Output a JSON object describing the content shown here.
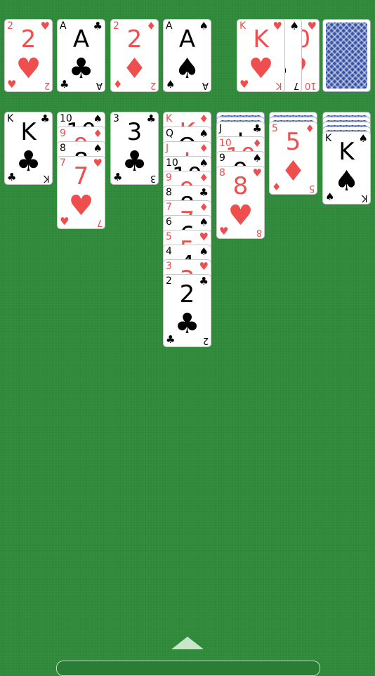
{
  "foundations": [
    {
      "rank": "2",
      "suit": "♥",
      "color": "red"
    },
    {
      "rank": "A",
      "suit": "♣",
      "color": "black"
    },
    {
      "rank": "2",
      "suit": "♦",
      "color": "red"
    },
    {
      "rank": "A",
      "suit": "♠",
      "color": "black"
    }
  ],
  "waste": [
    {
      "rank": "10",
      "suit": "♥",
      "color": "red"
    },
    {
      "rank": "7",
      "suit": "♠",
      "color": "black"
    },
    {
      "rank": "K",
      "suit": "♥",
      "color": "red"
    }
  ],
  "tableau": [
    {
      "hidden": 0,
      "cards": [
        {
          "rank": "K",
          "suit": "♣",
          "color": "black"
        }
      ]
    },
    {
      "hidden": 0,
      "cards": [
        {
          "rank": "10",
          "suit": "♠",
          "color": "black"
        },
        {
          "rank": "9",
          "suit": "♦",
          "color": "red"
        },
        {
          "rank": "8",
          "suit": "♠",
          "color": "black"
        },
        {
          "rank": "7",
          "suit": "♥",
          "color": "red"
        }
      ]
    },
    {
      "hidden": 0,
      "cards": [
        {
          "rank": "3",
          "suit": "♣",
          "color": "black"
        }
      ]
    },
    {
      "hidden": 0,
      "cards": [
        {
          "rank": "K",
          "suit": "♦",
          "color": "red"
        },
        {
          "rank": "Q",
          "suit": "♠",
          "color": "black"
        },
        {
          "rank": "J",
          "suit": "♦",
          "color": "red"
        },
        {
          "rank": "10",
          "suit": "♠",
          "color": "black"
        },
        {
          "rank": "9",
          "suit": "♦",
          "color": "red"
        },
        {
          "rank": "8",
          "suit": "♣",
          "color": "black"
        },
        {
          "rank": "7",
          "suit": "♦",
          "color": "red"
        },
        {
          "rank": "6",
          "suit": "♠",
          "color": "black"
        },
        {
          "rank": "5",
          "suit": "♥",
          "color": "red"
        },
        {
          "rank": "4",
          "suit": "♠",
          "color": "black"
        },
        {
          "rank": "3",
          "suit": "♥",
          "color": "red"
        },
        {
          "rank": "2",
          "suit": "♣",
          "color": "black"
        }
      ]
    },
    {
      "hidden": 2,
      "cards": [
        {
          "rank": "J",
          "suit": "♣",
          "color": "black"
        },
        {
          "rank": "10",
          "suit": "♦",
          "color": "red"
        },
        {
          "rank": "9",
          "suit": "♠",
          "color": "black"
        },
        {
          "rank": "8",
          "suit": "♥",
          "color": "red"
        }
      ]
    },
    {
      "hidden": 2,
      "cards": [
        {
          "rank": "5",
          "suit": "♦",
          "color": "red"
        }
      ]
    },
    {
      "hidden": 4,
      "cards": [
        {
          "rank": "K",
          "suit": "♠",
          "color": "black"
        }
      ]
    }
  ],
  "stock_remaining": true
}
